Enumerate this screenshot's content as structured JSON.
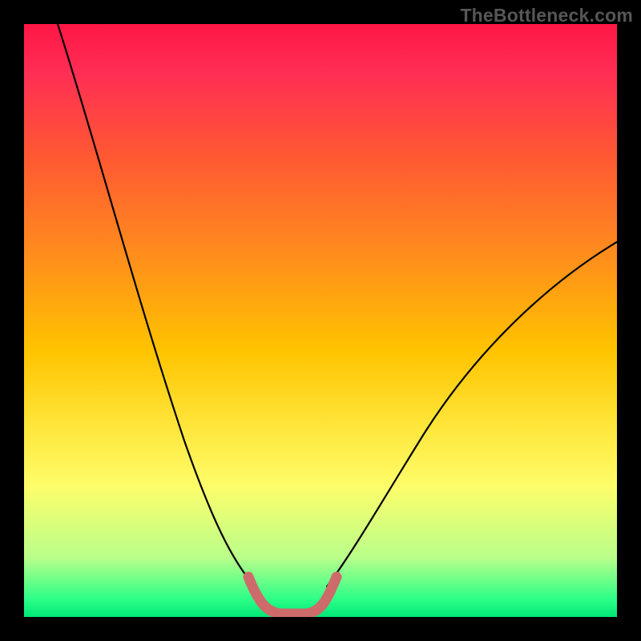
{
  "watermark": "TheBottleneck.com",
  "chart_data": {
    "type": "line",
    "title": "",
    "xlabel": "",
    "ylabel": "",
    "xlim": [
      0,
      100
    ],
    "ylim": [
      0,
      100
    ],
    "grid": false,
    "legend": false,
    "series": [
      {
        "name": "left-branch",
        "color": "#000000",
        "x": [
          6,
          10,
          14,
          18,
          22,
          26,
          30,
          32,
          34,
          36,
          38,
          40
        ],
        "values": [
          100,
          85,
          68,
          53,
          40,
          28,
          17,
          12,
          8,
          5,
          3,
          1
        ]
      },
      {
        "name": "valley-floor",
        "color": "#c95b5b",
        "x": [
          38,
          40,
          42,
          44,
          46,
          48,
          50,
          52
        ],
        "values": [
          5,
          1,
          0,
          0,
          0,
          0,
          1,
          5
        ]
      },
      {
        "name": "right-branch",
        "color": "#000000",
        "x": [
          50,
          54,
          58,
          62,
          66,
          72,
          78,
          86,
          94,
          100
        ],
        "values": [
          1,
          6,
          12,
          18,
          24,
          32,
          40,
          50,
          58,
          63
        ]
      }
    ],
    "gradient_stops": [
      {
        "offset": 0,
        "color": "#ff1744"
      },
      {
        "offset": 22,
        "color": "#ff5733"
      },
      {
        "offset": 55,
        "color": "#ffc300"
      },
      {
        "offset": 78,
        "color": "#fdfd6a"
      },
      {
        "offset": 100,
        "color": "#00e676"
      }
    ]
  }
}
